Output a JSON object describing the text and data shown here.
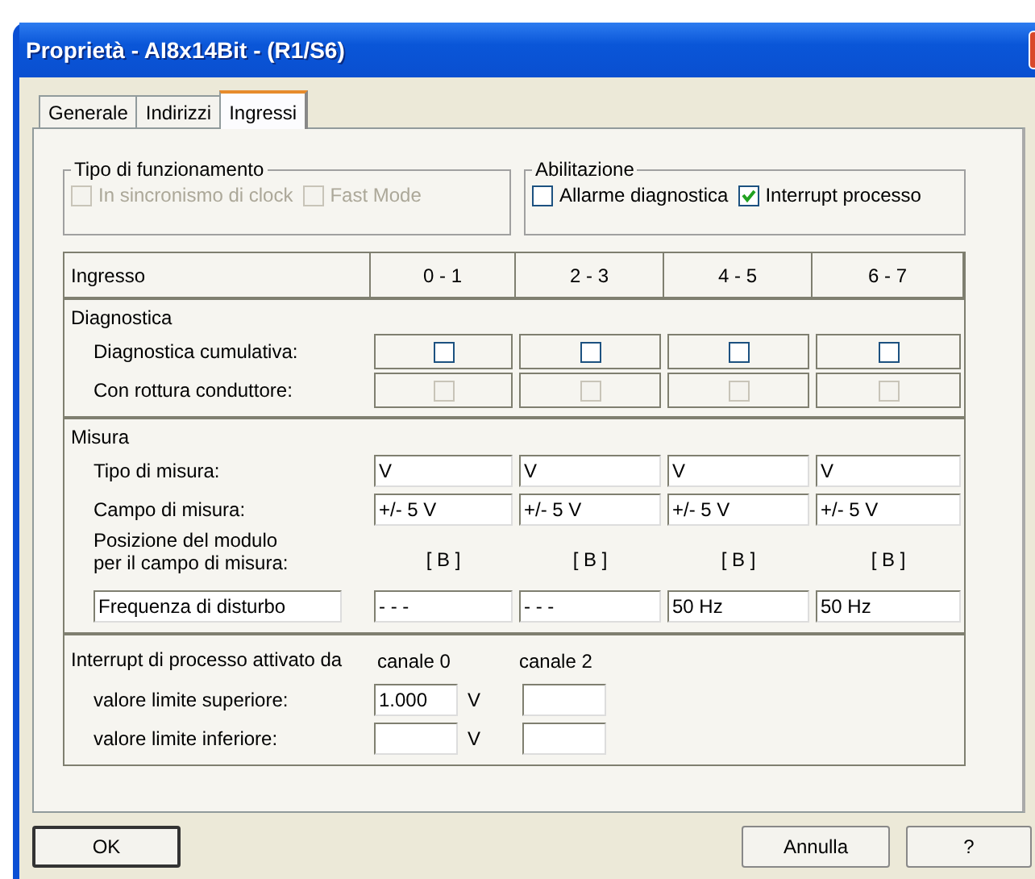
{
  "window": {
    "title": "Proprietà - AI8x14Bit - (R1/S6)"
  },
  "tabs": [
    {
      "label": "Generale",
      "selected": false
    },
    {
      "label": "Indirizzi",
      "selected": false
    },
    {
      "label": "Ingressi",
      "selected": true
    }
  ],
  "groups": [
    {
      "title": "Tipo di funzionamento",
      "options": [
        {
          "label": "In sincronismo di clock",
          "checked": false,
          "disabled": true
        },
        {
          "label": "Fast Mode",
          "checked": false,
          "disabled": true
        }
      ]
    },
    {
      "title": "Abilitazione",
      "options": [
        {
          "label": "Allarme diagnostica",
          "checked": false,
          "disabled": false
        },
        {
          "label": "Interrupt processo",
          "checked": true,
          "disabled": false
        }
      ]
    }
  ],
  "table": {
    "columns": [
      "Ingresso",
      "0 - 1",
      "2 - 3",
      "4 - 5",
      "6 - 7"
    ],
    "sections": [
      {
        "title": "Diagnostica",
        "rows": [
          {
            "kind": "checks",
            "label": "Diagnostica cumulativa:",
            "cells": [
              {
                "checked": false,
                "disabled": false
              },
              {
                "checked": false,
                "disabled": false
              },
              {
                "checked": false,
                "disabled": false
              },
              {
                "checked": false,
                "disabled": false
              }
            ]
          },
          {
            "kind": "checks",
            "label": "Con rottura conduttore:",
            "cells": [
              {
                "checked": false,
                "disabled": true
              },
              {
                "checked": false,
                "disabled": true
              },
              {
                "checked": false,
                "disabled": true
              },
              {
                "checked": false,
                "disabled": true
              }
            ]
          }
        ]
      },
      {
        "title": "Misura",
        "rows": [
          {
            "kind": "fields",
            "label": "Tipo di misura:",
            "values": [
              "V",
              "V",
              "V",
              "V"
            ]
          },
          {
            "kind": "fields",
            "label": "Campo di misura:",
            "values": [
              "+/- 5 V",
              "+/- 5 V",
              "+/- 5 V",
              "+/- 5 V"
            ]
          },
          {
            "kind": "texts",
            "label": "Posizione del modulo\nper il campo di misura:",
            "values": [
              "[ B ]",
              "[ B ]",
              "[ B ]",
              "[ B ]"
            ]
          },
          {
            "kind": "labeled_fields",
            "label": "Frequenza di disturbo",
            "values": [
              "- - -",
              "- - -",
              "50 Hz",
              "50 Hz"
            ]
          }
        ]
      }
    ]
  },
  "interrupt": {
    "title": "Interrupt di processo attivato da",
    "channels": [
      "canale 0",
      "canale 2"
    ],
    "rows": [
      {
        "label": "valore limite superiore:",
        "cells": [
          {
            "kind": "field",
            "value": "1.000",
            "unit": "V"
          },
          {
            "kind": "field"
          }
        ]
      },
      {
        "label": "valore limite inferiore:",
        "cells": [
          {
            "kind": "field",
            "unit": "V"
          },
          {
            "kind": "field"
          }
        ]
      }
    ]
  },
  "buttons": [
    {
      "label": "OK",
      "default": true
    },
    {
      "label": "Annulla",
      "default": false
    },
    {
      "label": "?",
      "default": false
    }
  ]
}
